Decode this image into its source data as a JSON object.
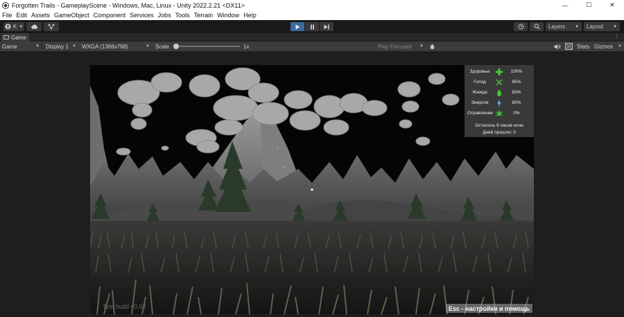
{
  "window": {
    "title": "Forgotten Trails - GameplayScene - Windows, Mac, Linux - Unity 2022.2.21 <DX11>",
    "controls": {
      "minimize": "—",
      "maximize": "☐",
      "close": "✕"
    }
  },
  "menu": [
    "File",
    "Edit",
    "Assets",
    "GameObject",
    "Component",
    "Services",
    "Jobs",
    "Tools",
    "Terrain",
    "Window",
    "Help"
  ],
  "toolbar": {
    "account_label": "K",
    "layers_label": "Layers",
    "layout_label": "Layout"
  },
  "tab": {
    "label": "Game",
    "menu": "⋮"
  },
  "game_toolbar": {
    "mode": "Game",
    "display": "Display 1",
    "resolution": "WXGA (1366x768)",
    "scale_label": "Scale",
    "scale_value": "1x",
    "play_mode": "Play Focused",
    "stats": "Stats",
    "gizmos": "Gizmos"
  },
  "hud": {
    "stats": [
      {
        "name": "Здоровье",
        "value": "100%",
        "icon": "health-cross-icon",
        "color": "#3ec93a"
      },
      {
        "name": "Голод",
        "value": "85%",
        "icon": "crossed-utensils-icon",
        "color": "#3ec93a"
      },
      {
        "name": "Жажда",
        "value": "83%",
        "icon": "water-drop-icon",
        "color": "#3ec93a"
      },
      {
        "name": "Энергия",
        "value": "80%",
        "icon": "lightning-icon",
        "color": "#7fb3ff"
      },
      {
        "name": "Отравление",
        "value": "0%",
        "icon": "bug-icon",
        "color": "#3ec93a"
      }
    ],
    "time_left": "Осталось 9 часов ночи",
    "days_passed": "Дней прошло: 0"
  },
  "overlay": {
    "build_label": "Test build v0.02",
    "help_label": "Esc - настройки и помощь"
  },
  "colors": {
    "accent": "#3b6a9b",
    "hud_green": "#3ec93a"
  }
}
